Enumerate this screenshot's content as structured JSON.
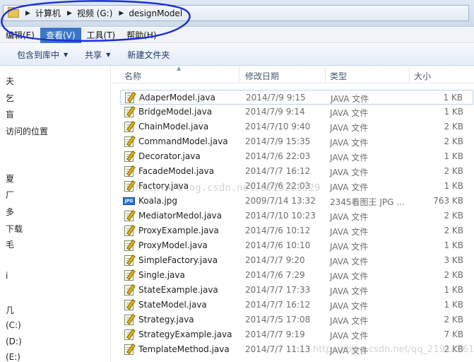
{
  "address": {
    "crumbs": [
      "计算机",
      "视频 (G:)",
      "designModel"
    ]
  },
  "menu": {
    "items": [
      {
        "label": "编辑(E)",
        "active": false
      },
      {
        "label": "查看(V)",
        "active": true
      },
      {
        "label": "工具(T)",
        "active": false
      },
      {
        "label": "帮助(H)",
        "active": false
      }
    ]
  },
  "toolbar": {
    "include_library": "包含到库中",
    "share": "共享",
    "new_folder": "新建文件夹"
  },
  "nav": {
    "items": [
      "夫",
      "乞",
      "盲",
      "访问的位置",
      "夏",
      "厂",
      "多",
      "下载",
      "毛",
      "i",
      "几",
      "(C:)",
      "(D:)",
      "(E:)"
    ]
  },
  "columns": {
    "name": "名称",
    "date": "修改日期",
    "type": "类型",
    "size": "大小"
  },
  "files": [
    {
      "name": "AdaperModel.java",
      "date": "2014/7/9 9:15",
      "type": "JAVA 文件",
      "size": "1 KB",
      "icon": "java-file-icon"
    },
    {
      "name": "BridgeModel.java",
      "date": "2014/7/9 9:14",
      "type": "JAVA 文件",
      "size": "1 KB",
      "icon": "java-file-icon"
    },
    {
      "name": "ChainModel.java",
      "date": "2014/7/10 9:40",
      "type": "JAVA 文件",
      "size": "2 KB",
      "icon": "java-file-icon"
    },
    {
      "name": "CommandModel.java",
      "date": "2014/7/9 15:35",
      "type": "JAVA 文件",
      "size": "2 KB",
      "icon": "java-file-icon"
    },
    {
      "name": "Decorator.java",
      "date": "2014/7/6 22:03",
      "type": "JAVA 文件",
      "size": "1 KB",
      "icon": "java-file-icon"
    },
    {
      "name": "FacadeModel.java",
      "date": "2014/7/7 16:12",
      "type": "JAVA 文件",
      "size": "2 KB",
      "icon": "java-file-icon"
    },
    {
      "name": "Factory.java",
      "date": "2014/7/6 22:03",
      "type": "JAVA 文件",
      "size": "1 KB",
      "icon": "java-file-icon"
    },
    {
      "name": "Koala.jpg",
      "date": "2009/7/14 13:32",
      "type": "2345看图王 JPG ...",
      "size": "763 KB",
      "icon": "jpg-file-icon"
    },
    {
      "name": "MediatorMedol.java",
      "date": "2014/7/10 10:23",
      "type": "JAVA 文件",
      "size": "2 KB",
      "icon": "java-file-icon"
    },
    {
      "name": "ProxyExample.java",
      "date": "2014/7/6 10:12",
      "type": "JAVA 文件",
      "size": "2 KB",
      "icon": "java-file-icon"
    },
    {
      "name": "ProxyModel.java",
      "date": "2014/7/6 10:10",
      "type": "JAVA 文件",
      "size": "1 KB",
      "icon": "java-file-icon"
    },
    {
      "name": "SimpleFactory.java",
      "date": "2014/7/7 9:20",
      "type": "JAVA 文件",
      "size": "3 KB",
      "icon": "java-file-icon"
    },
    {
      "name": "Single.java",
      "date": "2014/7/6 7:29",
      "type": "JAVA 文件",
      "size": "2 KB",
      "icon": "java-file-icon"
    },
    {
      "name": "StateExample.java",
      "date": "2014/7/7 17:33",
      "type": "JAVA 文件",
      "size": "1 KB",
      "icon": "java-file-icon"
    },
    {
      "name": "StateModel.java",
      "date": "2014/7/7 16:12",
      "type": "JAVA 文件",
      "size": "1 KB",
      "icon": "java-file-icon"
    },
    {
      "name": "Strategy.java",
      "date": "2014/7/5 17:08",
      "type": "JAVA 文件",
      "size": "2 KB",
      "icon": "java-file-icon"
    },
    {
      "name": "StrategyExample.java",
      "date": "2014/7/7 9:19",
      "type": "JAVA 文件",
      "size": "7 KB",
      "icon": "java-file-icon"
    },
    {
      "name": "TemplateMethod.java",
      "date": "2014/7/7 11:13",
      "type": "JAVA 文件",
      "size": "2 KB",
      "icon": "java-file-icon"
    }
  ],
  "watermarks": {
    "middle": "http://blog.csdn.net/u013263529",
    "corner": "https://blog.csdn.net/qq_21912761"
  },
  "colors": {
    "annotation": "#1a2fd6",
    "menu_active": "#3b76c8",
    "selection_border": "#bcd2ea"
  }
}
